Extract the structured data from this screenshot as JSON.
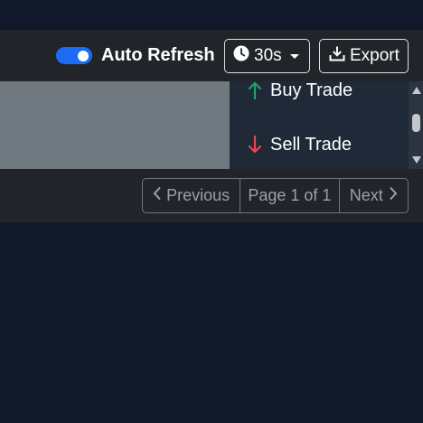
{
  "toolbar": {
    "auto_refresh_label": "Auto Refresh",
    "auto_refresh_on": true,
    "interval_label": "30s",
    "export_label": "Export",
    "accent_color": "#1b6cf2"
  },
  "dropdown": {
    "items": [
      {
        "label": "Buy Trade",
        "icon": "arrow-up-icon",
        "color": "#22a06b"
      },
      {
        "label": "Sell Trade",
        "icon": "arrow-down-icon",
        "color": "#e5484d"
      }
    ]
  },
  "pagination": {
    "previous_label": "Previous",
    "page_label": "Page 1 of 1",
    "next_label": "Next"
  }
}
